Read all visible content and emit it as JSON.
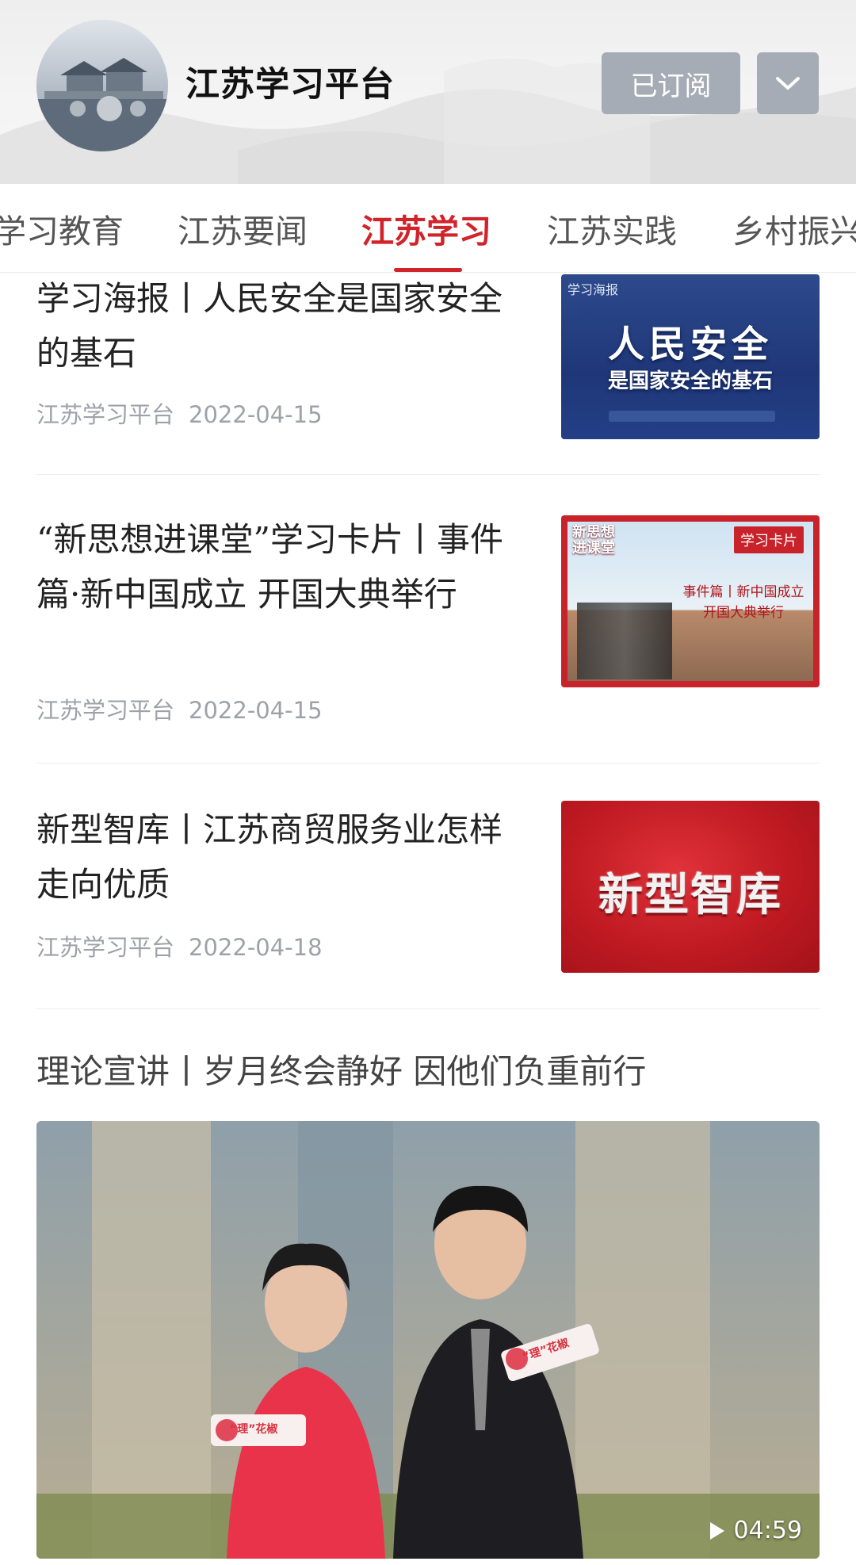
{
  "header": {
    "channel_name": "江苏学习平台",
    "subscribe_label": "已订阅"
  },
  "tabs": [
    {
      "label": "学习教育"
    },
    {
      "label": "江苏要闻"
    },
    {
      "label": "江苏学习",
      "active": true
    },
    {
      "label": "江苏实践"
    },
    {
      "label": "乡村振兴"
    }
  ],
  "articles": [
    {
      "title": "学习海报丨人民安全是国家安全的基石",
      "source": "江苏学习平台",
      "date": "2022-04-15",
      "thumb": {
        "corner": "学习海报",
        "line1": "人民安全",
        "line2": "是国家安全的基石"
      }
    },
    {
      "title": "“新思想进课堂”学习卡片丨事件篇·新中国成立 开国大典举行",
      "source": "江苏学习平台",
      "date": "2022-04-15",
      "thumb": {
        "corner": "新思想进课堂",
        "tag": "学习卡片",
        "line1": "事件篇丨新中国成立",
        "line2": "开国大典举行"
      }
    },
    {
      "title": "新型智库丨江苏商贸服务业怎样走向优质",
      "source": "江苏学习平台",
      "date": "2022-04-18",
      "thumb": {
        "text": "新型智库"
      }
    }
  ],
  "video": {
    "title": "理论宣讲丨岁月终会静好 因他们负重前行",
    "duration": "04:59",
    "badge": "“理”花椒"
  },
  "colors": {
    "accent": "#d0242a",
    "button_gray": "#a6acb5",
    "meta_gray": "#9ea2a8"
  }
}
